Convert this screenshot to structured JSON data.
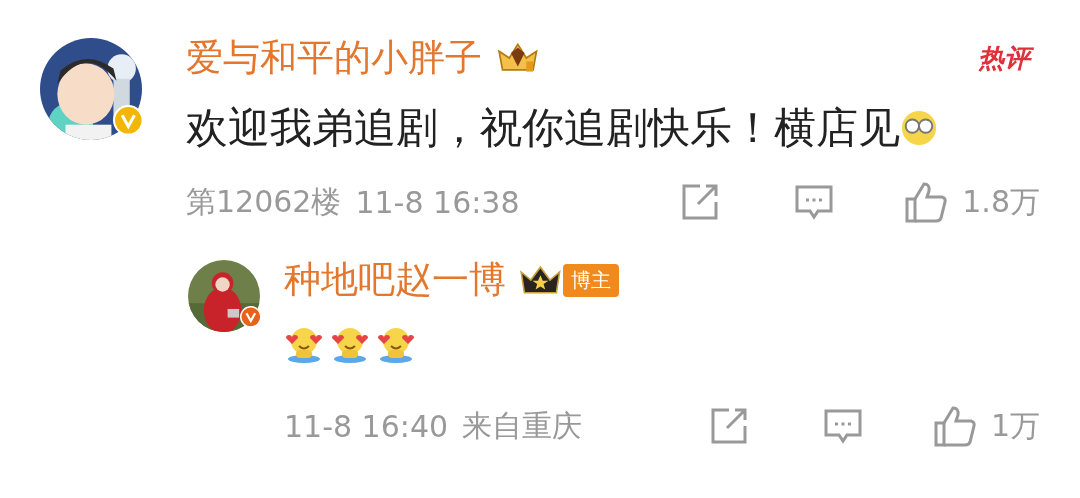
{
  "comment": {
    "author": "爱与和平的小胖子",
    "verified_badge": {
      "color": "#f2b705"
    },
    "rank": {
      "kind": "gold-crown"
    },
    "hot_tag": "热评",
    "text": "欢迎我弟追剧，祝你追剧快乐！横店见",
    "emojis": [
      {
        "kind": "glasses"
      }
    ],
    "floor": "第12062楼",
    "time": "11-8 16:38",
    "likes": "1.8万",
    "reply": {
      "author": "种地吧赵一博",
      "verified_badge": {
        "color": "#e8621a"
      },
      "rank": {
        "kind": "black-crown"
      },
      "role_tag": "博主",
      "emojis": [
        {
          "kind": "hug"
        },
        {
          "kind": "hug"
        },
        {
          "kind": "hug"
        }
      ],
      "time": "11-8 16:40",
      "location": "来自重庆",
      "likes": "1万"
    }
  }
}
